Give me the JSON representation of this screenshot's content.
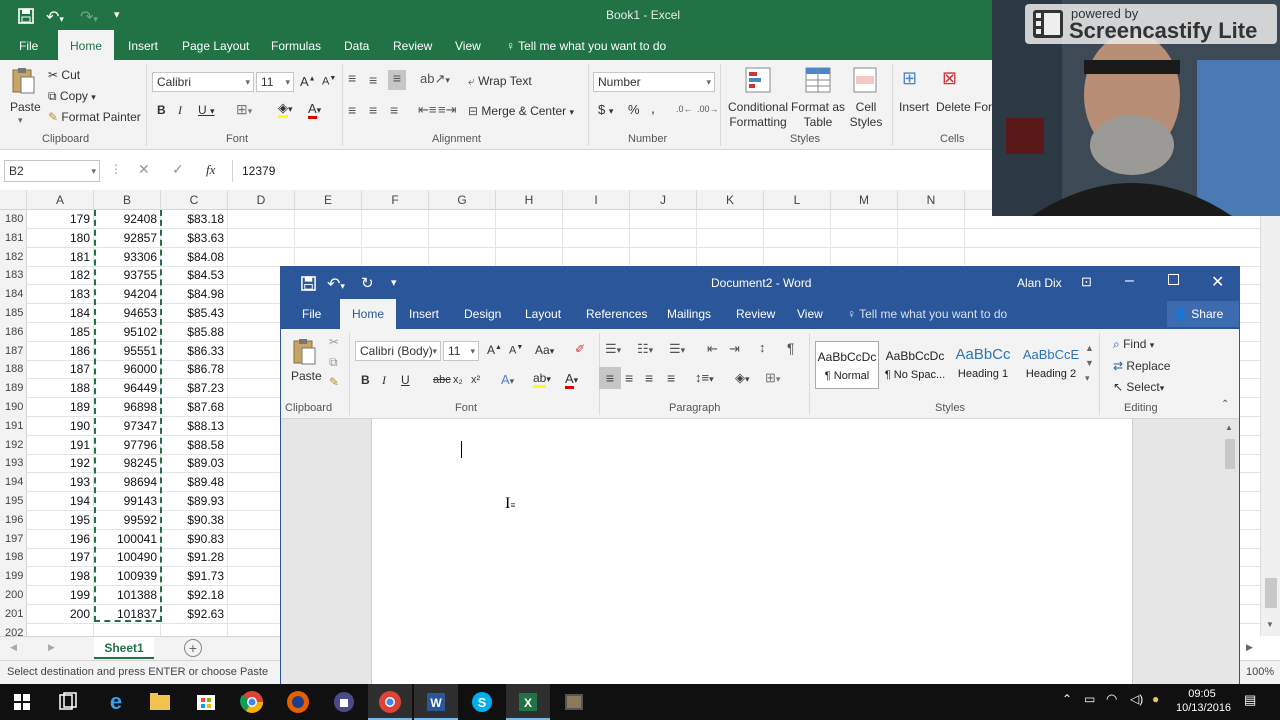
{
  "excel": {
    "title": "Book1 - Excel",
    "tabs": [
      "File",
      "Home",
      "Insert",
      "Page Layout",
      "Formulas",
      "Data",
      "Review",
      "View"
    ],
    "tell_me": "Tell me what you want to do",
    "clipboard": {
      "cut": "Cut",
      "copy": "Copy",
      "format_painter": "Format Painter",
      "paste": "Paste",
      "group": "Clipboard"
    },
    "font": {
      "name": "Calibri",
      "size": "11",
      "group": "Font"
    },
    "alignment": {
      "wrap": "Wrap Text",
      "merge": "Merge & Center",
      "group": "Alignment"
    },
    "number": {
      "format": "Number",
      "group": "Number"
    },
    "styles": {
      "conditional": "Conditional Formatting",
      "format_table": "Format as Table",
      "cell_styles": "Cell Styles",
      "group": "Styles"
    },
    "cells": {
      "insert": "Insert",
      "delete": "Delete",
      "format": "For",
      "group": "Cells"
    },
    "name_box": "B2",
    "formula": "12379",
    "fx": "fx",
    "columns": [
      "A",
      "B",
      "C",
      "D",
      "E",
      "F",
      "G",
      "H",
      "I",
      "J",
      "K",
      "L",
      "M",
      "N"
    ],
    "rows": [
      {
        "n": "180",
        "a": "179",
        "b": "92408",
        "c": "$83.18"
      },
      {
        "n": "181",
        "a": "180",
        "b": "92857",
        "c": "$83.63"
      },
      {
        "n": "182",
        "a": "181",
        "b": "93306",
        "c": "$84.08"
      },
      {
        "n": "183",
        "a": "182",
        "b": "93755",
        "c": "$84.53"
      },
      {
        "n": "184",
        "a": "183",
        "b": "94204",
        "c": "$84.98"
      },
      {
        "n": "185",
        "a": "184",
        "b": "94653",
        "c": "$85.43"
      },
      {
        "n": "186",
        "a": "185",
        "b": "95102",
        "c": "$85.88"
      },
      {
        "n": "187",
        "a": "186",
        "b": "95551",
        "c": "$86.33"
      },
      {
        "n": "188",
        "a": "187",
        "b": "96000",
        "c": "$86.78"
      },
      {
        "n": "189",
        "a": "188",
        "b": "96449",
        "c": "$87.23"
      },
      {
        "n": "190",
        "a": "189",
        "b": "96898",
        "c": "$87.68"
      },
      {
        "n": "191",
        "a": "190",
        "b": "97347",
        "c": "$88.13"
      },
      {
        "n": "192",
        "a": "191",
        "b": "97796",
        "c": "$88.58"
      },
      {
        "n": "193",
        "a": "192",
        "b": "98245",
        "c": "$89.03"
      },
      {
        "n": "194",
        "a": "193",
        "b": "98694",
        "c": "$89.48"
      },
      {
        "n": "195",
        "a": "194",
        "b": "99143",
        "c": "$89.93"
      },
      {
        "n": "196",
        "a": "195",
        "b": "99592",
        "c": "$90.38"
      },
      {
        "n": "197",
        "a": "196",
        "b": "100041",
        "c": "$90.83"
      },
      {
        "n": "198",
        "a": "197",
        "b": "100490",
        "c": "$91.28"
      },
      {
        "n": "199",
        "a": "198",
        "b": "100939",
        "c": "$91.73"
      },
      {
        "n": "200",
        "a": "199",
        "b": "101388",
        "c": "$92.18"
      },
      {
        "n": "201",
        "a": "200",
        "b": "101837",
        "c": "$92.63"
      },
      {
        "n": "202",
        "a": "",
        "b": "",
        "c": ""
      }
    ],
    "sheet_tab": "Sheet1",
    "status": "Select destination and press ENTER or choose Paste",
    "zoom": "100%",
    "accent": "#217346"
  },
  "word": {
    "title": "Document2 - Word",
    "user": "Alan Dix",
    "share": "Share",
    "tabs": [
      "File",
      "Home",
      "Insert",
      "Design",
      "Layout",
      "References",
      "Mailings",
      "Review",
      "View"
    ],
    "tell_me": "Tell me what you want to do",
    "font_name": "Calibri (Body)",
    "font_size": "11",
    "styles": [
      {
        "preview": "AaBbCcDc",
        "label": "¶ Normal"
      },
      {
        "preview": "AaBbCcDc",
        "label": "¶ No Spac..."
      },
      {
        "preview": "AaBbCc",
        "label": "Heading 1"
      },
      {
        "preview": "AaBbCcE",
        "label": "Heading 2"
      }
    ],
    "editing": {
      "find": "Find",
      "replace": "Replace",
      "select": "Select"
    },
    "groups": {
      "clipboard": "Clipboard",
      "font": "Font",
      "paragraph": "Paragraph",
      "styles": "Styles",
      "editing": "Editing"
    },
    "paste": "Paste",
    "accent": "#2b579a"
  },
  "overlay": {
    "powered_by": "powered by",
    "brand": "Screencastify Lite"
  },
  "taskbar": {
    "time": "09:05",
    "date": "10/13/2016"
  }
}
